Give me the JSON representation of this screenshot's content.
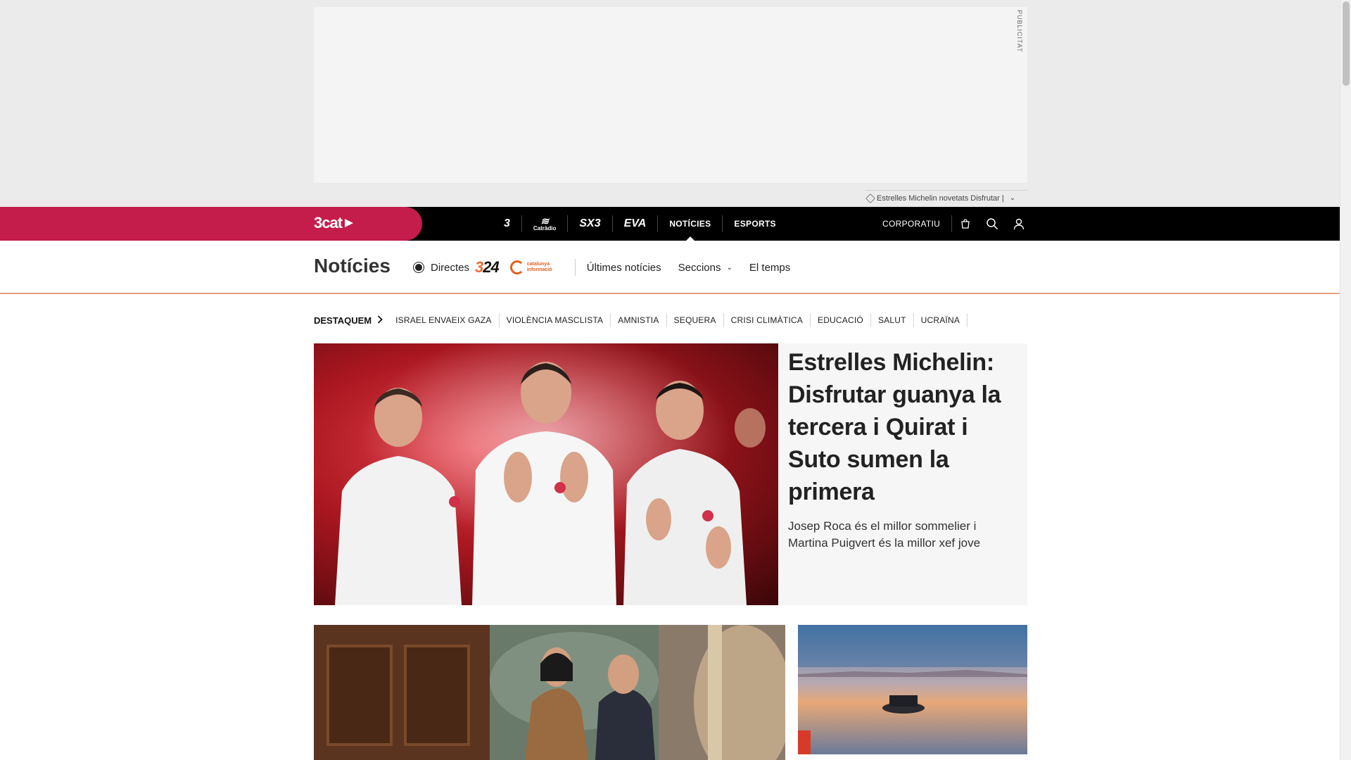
{
  "ad": {
    "label": "PUBLICITAT",
    "breaking_text": "Estrelles Michelin novetats Disfrutar |"
  },
  "global_nav": {
    "brand": "3cat",
    "channels": [
      "3",
      "Catràdio",
      "SX3",
      "EVA"
    ],
    "links": [
      "NOTÍCIES",
      "ESPORTS"
    ],
    "active": "NOTÍCIES",
    "corporate": "CORPORATIU",
    "icons": [
      "shop-bag-icon",
      "search-icon",
      "user-icon"
    ]
  },
  "section": {
    "title": "Notícies",
    "directes": "Directes",
    "logo_324": "324",
    "logo_ci": "catalunya informació",
    "links": [
      "Últimes notícies",
      "Seccions",
      "El temps"
    ]
  },
  "tags": {
    "lead": "DESTAQUEM",
    "items": [
      "ISRAEL ENVAEIX GAZA",
      "VIOLÈNCIA MASCLISTA",
      "AMNISTIA",
      "SEQUERA",
      "CRISI CLIMÀTICA",
      "EDUCACIÓ",
      "SALUT",
      "UCRAÏNA"
    ]
  },
  "hero": {
    "headline": "Estrelles Michelin: Disfrutar guanya la tercera i Quirat i Suto sumen la primera",
    "subtitle": "Josep Roca és el millor sommelier i Martina Puigvert és la millor xef jove"
  },
  "colors": {
    "brand_red": "#c41c4b",
    "nav_black": "#000000",
    "accent_orange": "#e0601f"
  }
}
